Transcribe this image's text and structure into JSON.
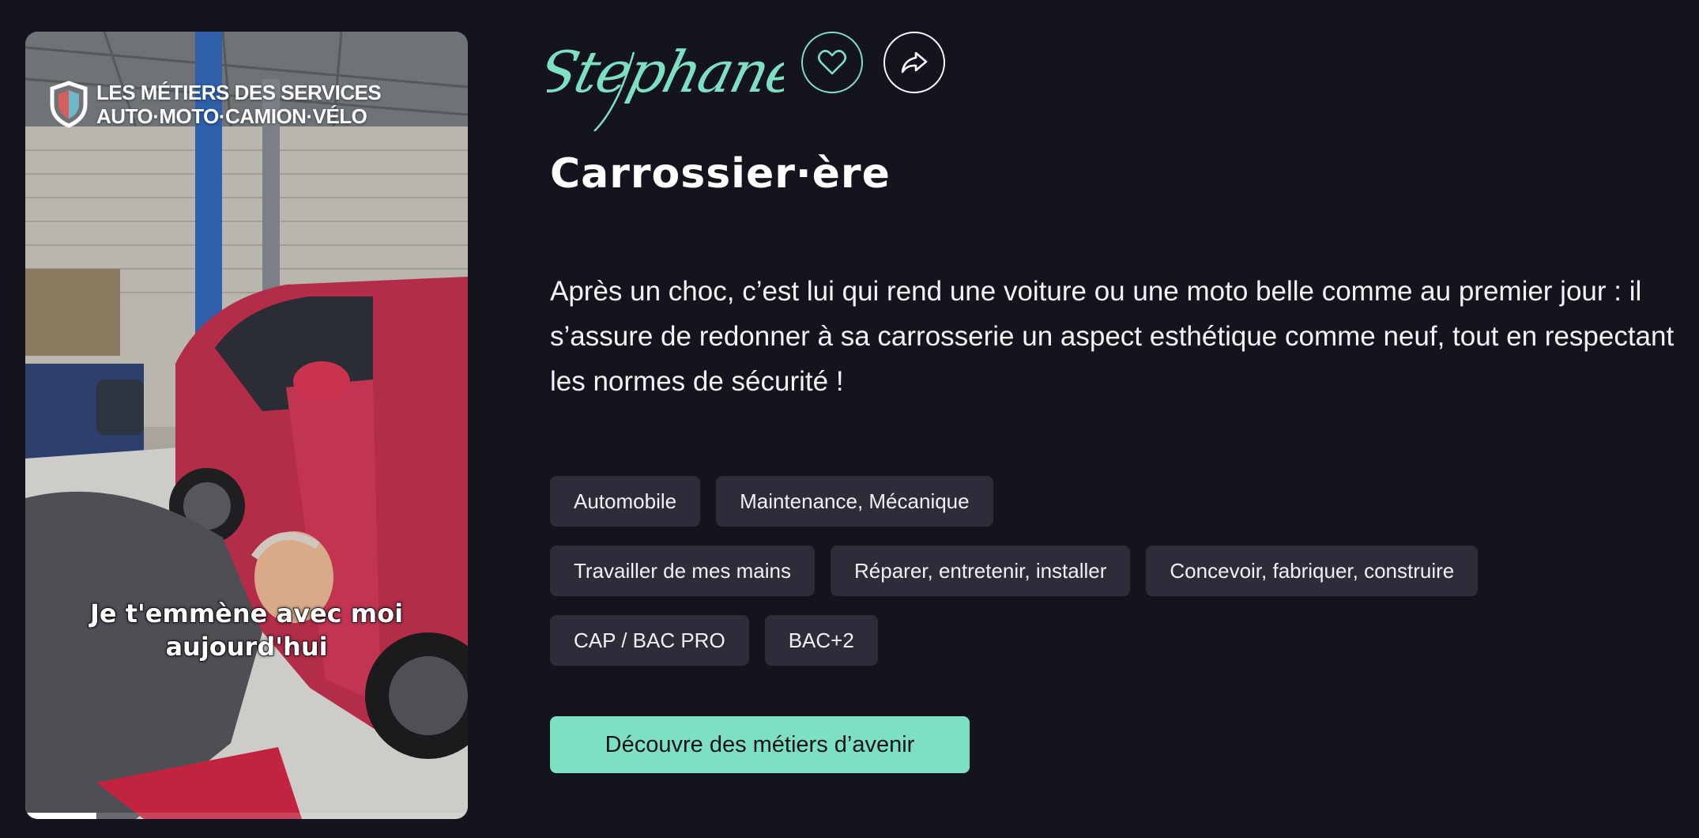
{
  "video": {
    "logo_line1": "LES MÉTIERS DES SERVICES",
    "logo_line2": "AUTO·MOTO·CAMION·VÉLO",
    "caption": "Je t'emmène avec moi\naujourd'hui",
    "progress_fraction": 0.16
  },
  "profile": {
    "first_name": "Stephane",
    "job_title": "Carrossier·ère",
    "description": "Après un choc, c’est lui qui rend une voiture ou une moto belle comme au premier jour : il s’assure de redonner à sa carrosserie un aspect esthétique comme neuf, tout en respectant les normes de sécurité !"
  },
  "actions": {
    "like_icon": "heart-icon",
    "share_icon": "share-arrow-icon"
  },
  "tags": {
    "sectors": [
      "Automobile",
      "Maintenance, Mécanique"
    ],
    "activities": [
      "Travailler de mes mains",
      "Réparer, entretenir, installer",
      "Concevoir, fabriquer, construire"
    ],
    "levels": [
      "CAP / BAC PRO",
      "BAC+2"
    ]
  },
  "cta": {
    "label": "Découvre des métiers d’avenir"
  },
  "colors": {
    "background": "#13141d",
    "accent": "#7ee0c2",
    "tag_background": "#2c2d38"
  }
}
